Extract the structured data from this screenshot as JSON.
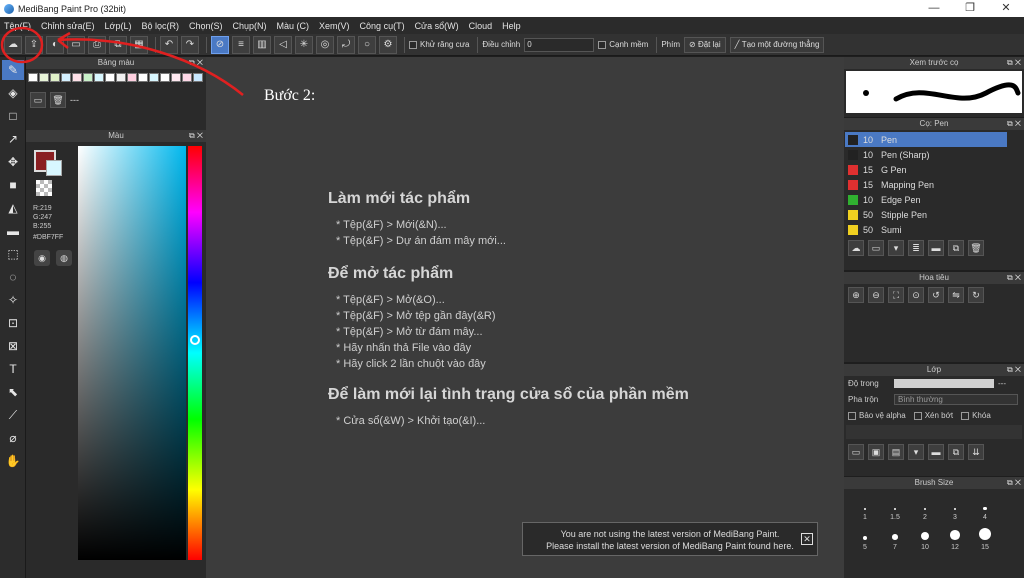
{
  "window": {
    "title": "MediBang Paint Pro (32bit)",
    "controls": [
      "—",
      "❐",
      "✕"
    ]
  },
  "menu": [
    "Tệp(F)",
    "Chỉnh sửa(E)",
    "Lớp(L)",
    "Bộ lọc(R)",
    "Chọn(S)",
    "Chụp(N)",
    "Màu (C)",
    "Xem(V)",
    "Công cụ(T)",
    "Cửa sổ(W)",
    "Cloud",
    "Help"
  ],
  "toolbar": {
    "antialias_label": "Khử răng cưa",
    "adjust_label": "Điều chỉnh",
    "adjust_value": "0",
    "edge_label": "Cạnh mềm",
    "key_label": "Phím",
    "reset_label": "Đặt lại",
    "create_line_label": "Tạo một đường thẳng"
  },
  "palette": {
    "title": "Bảng màu",
    "colors": [
      "#ffffff",
      "#e8f5d8",
      "#dff0c8",
      "#d4f0ff",
      "#ffe0e8",
      "#c8f0c8",
      "#d8f7ff",
      "#ffffff",
      "#f0f0f0",
      "#ffd0e0",
      "#ffffff",
      "#d8f7ff",
      "#ffffff",
      "#ffe8f0",
      "#ffd8e8",
      "#c8e8ff"
    ],
    "footer_text": "---"
  },
  "color": {
    "title": "Màu",
    "r": "R:219",
    "g": "G:247",
    "b": "B:255",
    "hex": "#DBF7FF"
  },
  "canvas": {
    "step_label": "Bước 2:",
    "sections": [
      {
        "heading": "Làm mới tác phẩm",
        "lines": [
          "* Tệp(&F) > Mới(&N)...",
          "* Tệp(&F) > Dự án đám mây mới..."
        ]
      },
      {
        "heading": "Để mở tác phẩm",
        "lines": [
          "* Tệp(&F) > Mở(&O)...",
          "* Tệp(&F) > Mở tệp gần đây(&R)",
          "* Tệp(&F) > Mở từ đám mây...",
          "* Hãy nhấn thả File vào đây",
          "* Hãy click 2 lần chuột vào đây"
        ]
      },
      {
        "heading": "Để làm mới lại tình trạng cửa sổ của phần mềm",
        "lines": [
          "* Cửa sổ(&W) > Khởi tạo(&I)..."
        ]
      }
    ],
    "notice_line1": "You are not using the latest version of MediBang Paint.",
    "notice_line2": "Please install the latest version of MediBang Paint found here."
  },
  "preview": {
    "title": "Xem trước cọ"
  },
  "brushes": {
    "title": "Cọ: Pen",
    "items": [
      {
        "size": "10",
        "name": "Pen",
        "color": "#222222"
      },
      {
        "size": "10",
        "name": "Pen (Sharp)",
        "color": "#222222"
      },
      {
        "size": "15",
        "name": "G Pen",
        "color": "#e03030"
      },
      {
        "size": "15",
        "name": "Mapping Pen",
        "color": "#e03030"
      },
      {
        "size": "10",
        "name": "Edge Pen",
        "color": "#30b030"
      },
      {
        "size": "50",
        "name": "Stipple Pen",
        "color": "#f0d020"
      },
      {
        "size": "50",
        "name": "Sumi",
        "color": "#f0d020"
      }
    ]
  },
  "navigator": {
    "title": "Hoa tiêu"
  },
  "layers": {
    "title": "Lớp",
    "opacity_label": "Độ trong",
    "opacity_value": "---",
    "blend_label": "Pha trộn",
    "blend_value": "Bình thường",
    "protect_alpha": "Bảo vệ alpha",
    "clipping": "Xén bớt",
    "lock": "Khóa"
  },
  "brush_size": {
    "title": "Brush Size",
    "sizes": [
      "1",
      "1.5",
      "2",
      "3",
      "4",
      "5",
      "7",
      "10",
      "12",
      "15"
    ]
  },
  "colors": {
    "accent": "#4a79c4",
    "annotation": "#e02020"
  }
}
